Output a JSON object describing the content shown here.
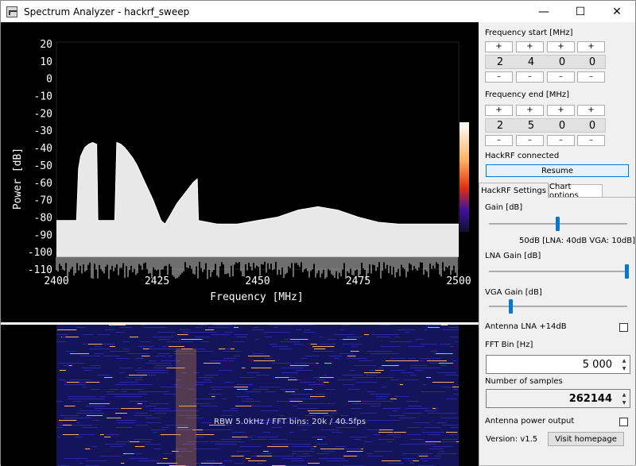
{
  "window": {
    "title": "Spectrum Analyzer - hackrf_sweep",
    "minimize_glyph": "—",
    "maximize_glyph": "☐",
    "close_glyph": "✕"
  },
  "chart_data": {
    "type": "line",
    "xlabel": "Frequency [MHz]",
    "ylabel": "Power [dB]",
    "xlim": [
      2400,
      2500
    ],
    "ylim": [
      -110,
      20
    ],
    "x_ticks": [
      "2400",
      "2425",
      "2450",
      "2475",
      "2500"
    ],
    "y_ticks": [
      "20",
      "10",
      "0",
      "-10",
      "-20",
      "-30",
      "-40",
      "-50",
      "-60",
      "-70",
      "-80",
      "-90",
      "-100",
      "-110"
    ],
    "series": [
      {
        "x": [
          2400,
          2405,
          2405.5,
          2406,
          2407,
          2408,
          2409,
          2410,
          2410.3,
          2414.5,
          2415,
          2416,
          2417,
          2418,
          2419,
          2420,
          2421,
          2422,
          2423,
          2424,
          2425,
          2426,
          2427,
          2428,
          2430,
          2432,
          2434,
          2435,
          2435.3,
          2440,
          2445,
          2450,
          2455,
          2460,
          2465,
          2470,
          2475,
          2480,
          2485,
          2490,
          2495,
          2500
        ],
        "y": [
          -82,
          -82,
          -52,
          -45,
          -40,
          -38,
          -37,
          -38,
          -82,
          -82,
          -37,
          -38,
          -40,
          -43,
          -46,
          -50,
          -55,
          -60,
          -65,
          -70,
          -76,
          -82,
          -84,
          -80,
          -72,
          -66,
          -60,
          -58,
          -82,
          -84,
          -84,
          -82,
          -80,
          -76,
          -74,
          -76,
          -80,
          -83,
          -84,
          -84,
          -84,
          -84
        ]
      }
    ]
  },
  "waterfall": {
    "info": "RBW 5.0kHz / FFT bins: 20k / 40.5fps",
    "accent": "#ffb060",
    "background": "#14145a"
  },
  "panel": {
    "freq_start_label": "Frequency start [MHz]",
    "freq_start_digits": [
      "2",
      "4",
      "0",
      "0"
    ],
    "freq_end_label": "Frequency end [MHz]",
    "freq_end_digits": [
      "2",
      "5",
      "0",
      "0"
    ],
    "plus": "+",
    "minus": "–",
    "status": "HackRF connected",
    "resume_label": "Resume",
    "tabs": [
      "HackRF Settings",
      "Chart options"
    ],
    "gain_label": "Gain [dB]",
    "gain_value": 0.5,
    "gain_readout": "50dB  [LNA: 40dB  VGA: 10dB]",
    "lna_label": "LNA Gain [dB]",
    "lna_value": 1.0,
    "vga_label": "VGA Gain [dB]",
    "vga_value": 0.16,
    "antenna_lna_label": "Antenna LNA +14dB",
    "fft_bin_label": "FFT Bin [Hz]",
    "fft_bin_value": "5 000",
    "samples_label": "Number of samples",
    "samples_value": "262144",
    "antenna_power_label": "Antenna power output",
    "version": "Version: v1.5",
    "visit_label": "Visit homepage",
    "accent_color": "#0078d7"
  }
}
